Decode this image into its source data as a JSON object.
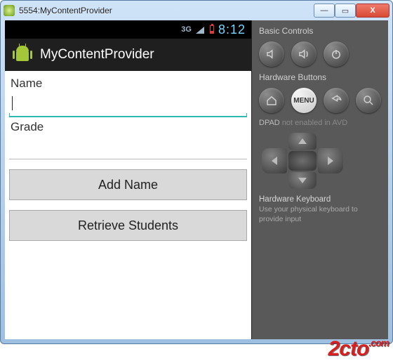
{
  "window": {
    "title": "5554:MyContentProvider",
    "buttons": {
      "min": "—",
      "max": "▭",
      "close": "X"
    }
  },
  "status_bar": {
    "network": "3G",
    "time": "8:12"
  },
  "action_bar": {
    "title": "MyContentProvider"
  },
  "form": {
    "name_label": "Name",
    "name_value": "",
    "grade_label": "Grade",
    "grade_value": "",
    "add_button": "Add Name",
    "retrieve_button": "Retrieve Students"
  },
  "panel": {
    "basic_title": "Basic Controls",
    "hw_title": "Hardware Buttons",
    "menu_label": "MENU",
    "dpad_label": "DPAD",
    "dpad_status": "not enabled in AVD",
    "kbd_title": "Hardware Keyboard",
    "kbd_note": "Use your physical keyboard to provide input"
  },
  "watermark": {
    "text": "2cto",
    "suffix": ".com"
  }
}
